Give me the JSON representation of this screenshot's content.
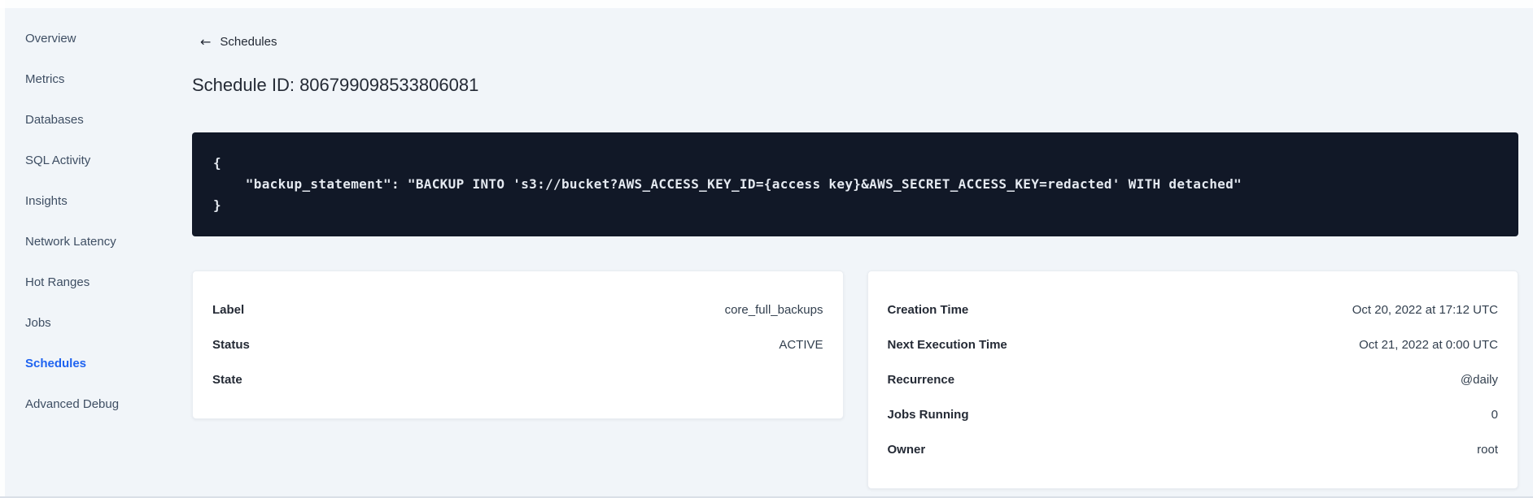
{
  "sidebar": {
    "items": [
      {
        "label": "Overview",
        "active": false
      },
      {
        "label": "Metrics",
        "active": false
      },
      {
        "label": "Databases",
        "active": false
      },
      {
        "label": "SQL Activity",
        "active": false
      },
      {
        "label": "Insights",
        "active": false
      },
      {
        "label": "Network Latency",
        "active": false
      },
      {
        "label": "Hot Ranges",
        "active": false
      },
      {
        "label": "Jobs",
        "active": false
      },
      {
        "label": "Schedules",
        "active": true
      },
      {
        "label": "Advanced Debug",
        "active": false
      }
    ]
  },
  "header": {
    "back_icon_glyph": "←",
    "back_label": "Schedules",
    "title": "Schedule ID: 806799098533806081"
  },
  "code_block": {
    "lines": [
      "{",
      "    \"backup_statement\": \"BACKUP INTO 's3://bucket?AWS_ACCESS_KEY_ID={access key}&AWS_SECRET_ACCESS_KEY=redacted' WITH detached\"",
      "}"
    ]
  },
  "schedule_details": {
    "rows": [
      {
        "label": "Label",
        "value": "core_full_backups"
      },
      {
        "label": "Status",
        "value": "ACTIVE"
      },
      {
        "label": "State",
        "value": ""
      }
    ]
  },
  "execution_details": {
    "rows": [
      {
        "label": "Creation Time",
        "value": "Oct 20, 2022 at 17:12 UTC"
      },
      {
        "label": "Next Execution Time",
        "value": "Oct 21, 2022 at 0:00 UTC"
      },
      {
        "label": "Recurrence",
        "value": "@daily"
      },
      {
        "label": "Jobs Running",
        "value": "0"
      },
      {
        "label": "Owner",
        "value": "root"
      }
    ]
  },
  "colors": {
    "accent_blue": "#1f63f0",
    "page_background": "#f1f5f9",
    "card_background": "#ffffff",
    "code_background": "#111827",
    "code_text": "#e4e9f0",
    "heading_text": "#242a35"
  }
}
